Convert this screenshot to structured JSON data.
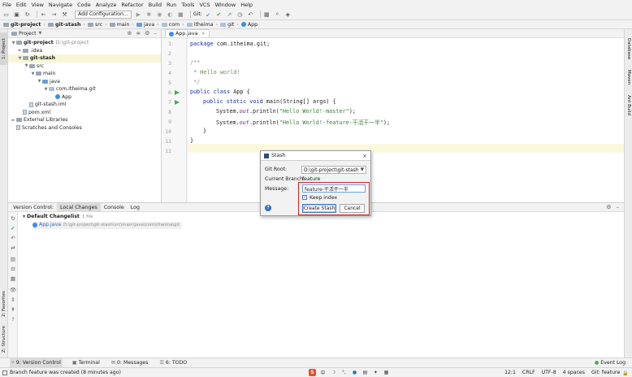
{
  "menubar": [
    "File",
    "Edit",
    "View",
    "Navigate",
    "Code",
    "Analyze",
    "Refactor",
    "Build",
    "Run",
    "Tools",
    "VCS",
    "Window",
    "Help"
  ],
  "toolbar": {
    "add_config": "Add Configuration...",
    "git_label": "Git:"
  },
  "breadcrumb": [
    "git-project",
    "git-stash",
    "src",
    "main",
    "java",
    "com",
    "itheima",
    "git",
    "App"
  ],
  "project_panel": {
    "title": "Project",
    "tree": [
      {
        "indent": 0,
        "arrow": "▼",
        "icon": "folder",
        "label": "git-project",
        "extra": "D:\\git-project",
        "bold": true
      },
      {
        "indent": 1,
        "arrow": "►",
        "icon": "folder",
        "label": ".idea",
        "extra": ""
      },
      {
        "indent": 1,
        "arrow": "▼",
        "icon": "folder",
        "label": "git-stash",
        "extra": "",
        "bold": true,
        "highlight": true
      },
      {
        "indent": 2,
        "arrow": "▼",
        "icon": "folder",
        "label": "src",
        "extra": ""
      },
      {
        "indent": 3,
        "arrow": "▼",
        "icon": "folder",
        "label": "main",
        "extra": ""
      },
      {
        "indent": 4,
        "arrow": "▼",
        "icon": "folder-blue",
        "label": "java",
        "extra": ""
      },
      {
        "indent": 5,
        "arrow": "▼",
        "icon": "package",
        "label": "com.itheima.git",
        "extra": ""
      },
      {
        "indent": 6,
        "arrow": "",
        "icon": "class",
        "label": "App",
        "extra": ""
      },
      {
        "indent": 2,
        "arrow": "",
        "icon": "file",
        "label": "git-stash.iml",
        "extra": ""
      },
      {
        "indent": 1,
        "arrow": "",
        "icon": "file",
        "label": "pom.xml",
        "extra": ""
      },
      {
        "indent": 0,
        "arrow": "►",
        "icon": "library",
        "label": "External Libraries",
        "extra": ""
      },
      {
        "indent": 0,
        "arrow": "",
        "icon": "scratch",
        "label": "Scratches and Consoles",
        "extra": ""
      }
    ]
  },
  "editor": {
    "tab": "App.java",
    "line_numbers": [
      "1",
      "2",
      "3",
      "4",
      "5",
      "6",
      "7",
      "8",
      "9",
      "10",
      "11",
      "12"
    ],
    "lines": {
      "l1_kw": "package",
      "l1_rest": " com.itheima.git;",
      "l3": "/**",
      "l4": " * Hello world!",
      "l5": " */",
      "l6_kw": "public class",
      "l6_rest": " App {",
      "l7_kw": "public static void",
      "l7_rest": " main(String[] args) {",
      "l8_a": "System.",
      "l8_b": "out",
      "l8_c": ".println(",
      "l8_str": "\"Hello World!-master\"",
      "l8_d": ");",
      "l9_a": "System.",
      "l9_b": "out",
      "l9_c": ".println(",
      "l9_str": "\"Hello World!-feature-干活干一半\"",
      "l9_d": ");",
      "l10": "}",
      "l11": "}"
    }
  },
  "vc_panel": {
    "tabs": [
      "Version Control:",
      "Local Changes",
      "Console",
      "Log"
    ],
    "changelist": "Default Changelist",
    "changelist_count": "1 file",
    "file_name": "App.java",
    "file_path": "D:\\git-project\\git-stash\\src\\main\\java\\com\\itheima\\git"
  },
  "dialog": {
    "title": "Stash",
    "git_root_label": "Git Root:",
    "git_root_value": "D:\\git-project\\git-stash",
    "branch_label": "Current Branch:",
    "branch_value": "feature",
    "message_label": "Message:",
    "message_value": "feature-干活干一半",
    "keep_index": "Keep index",
    "create_btn": "Create Stash",
    "cancel_btn": "Cancel",
    "help": "?"
  },
  "left_stripe": {
    "project": "1: Project",
    "favorites": "2: Favorites",
    "structure": "Z: Structure"
  },
  "right_stripe": {
    "database": "Database",
    "maven": "Maven",
    "ant": "Ant Build"
  },
  "bottom_tools": [
    "9: Version Control",
    "Terminal",
    "0: Messages",
    "6: TODO"
  ],
  "event_log": "Event Log",
  "status": {
    "message": "Branch feature was created (8 minutes ago)",
    "position": "12:1",
    "line_sep": "CRLF",
    "encoding": "UTF-8",
    "indent": "4 spaces",
    "branch": "Git: feature"
  },
  "colors": {
    "accent": "#3c7ccc",
    "highlight_red": "#d9231f",
    "keyword": "#1a2ea6",
    "string": "#3a7a3a"
  }
}
